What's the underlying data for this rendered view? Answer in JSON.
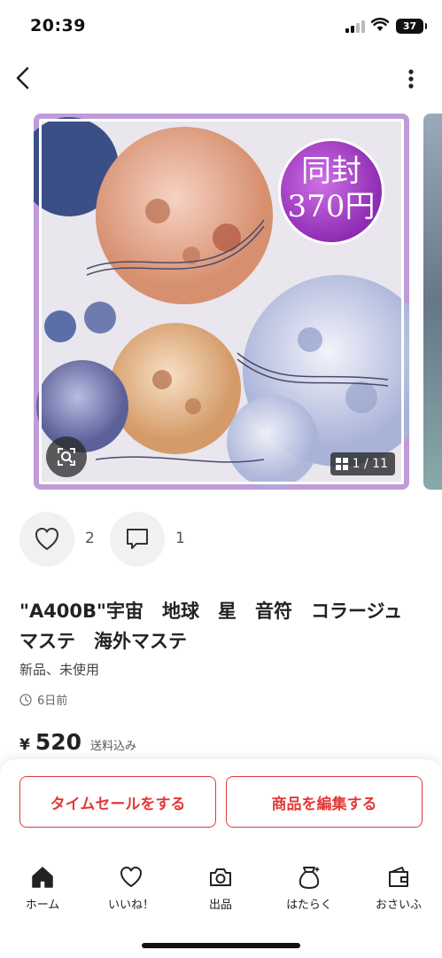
{
  "status_bar": {
    "time": "20:39",
    "battery": "37"
  },
  "nav": {
    "back_icon": "chevron-left-icon",
    "more_icon": "more-vertical-icon"
  },
  "gallery": {
    "badge_line1": "同封",
    "badge_line2": "370円",
    "counter": "1 / 11",
    "lens_icon": "image-search-icon",
    "counter_icon": "grid-icon"
  },
  "actions": {
    "likes": "2",
    "comments": "1"
  },
  "product": {
    "title": "\"A400B\"宇宙　地球　星　音符　コラージュ　マステ　海外マステ",
    "condition": "新品、未使用",
    "posted": "6日前",
    "price_symbol": "¥",
    "price": "520",
    "shipping": "送料込み"
  },
  "buttons": {
    "timesale": "タイムセールをする",
    "edit": "商品を編集する"
  },
  "tabs": [
    {
      "label": "ホーム",
      "icon": "home-icon"
    },
    {
      "label": "いいね！",
      "icon": "heart-icon"
    },
    {
      "label": "出品",
      "icon": "camera-icon"
    },
    {
      "label": "はたらく",
      "icon": "money-bag-icon"
    },
    {
      "label": "おさいふ",
      "icon": "wallet-icon"
    }
  ],
  "colors": {
    "accent": "#e23a3a",
    "frame": "#c09bd9",
    "badge": "#a43fcc"
  }
}
